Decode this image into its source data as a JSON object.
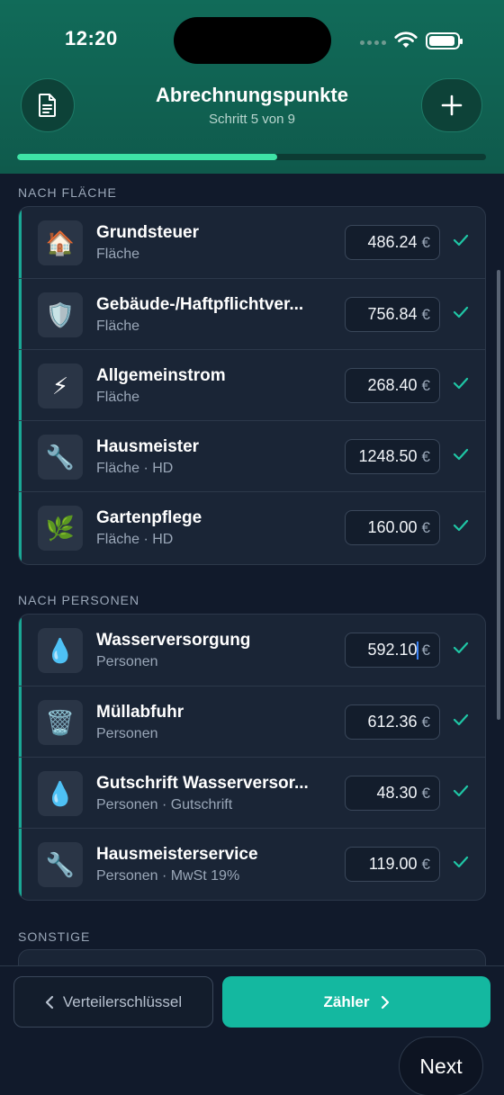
{
  "status": {
    "time": "12:20"
  },
  "header": {
    "title": "Abrechnungspunkte",
    "subtitle": "Schritt 5 von 9",
    "progress": 0.555
  },
  "sections": [
    {
      "label": "NACH FLÄCHE",
      "items": [
        {
          "icon": "house-icon",
          "glyph": "🏠",
          "title": "Grundsteuer",
          "sub": "Fläche",
          "amount": "486.24"
        },
        {
          "icon": "shield-icon",
          "glyph": "🛡️",
          "title": "Gebäude-/Haftpflichtver...",
          "sub": "Fläche",
          "amount": "756.84"
        },
        {
          "icon": "lightning-icon",
          "glyph": "⚡",
          "title": "Allgemeinstrom",
          "sub": "Fläche",
          "amount": "268.40"
        },
        {
          "icon": "wrench-icon",
          "glyph": "🔧",
          "title": "Hausmeister",
          "sub": "Fläche · HD",
          "amount": "1248.50"
        },
        {
          "icon": "herb-icon",
          "glyph": "🌿",
          "title": "Gartenpflege",
          "sub": "Fläche · HD",
          "amount": "160.00"
        }
      ]
    },
    {
      "label": "NACH PERSONEN",
      "items": [
        {
          "icon": "droplet-icon",
          "glyph": "💧",
          "title": "Wasserversorgung",
          "sub": "Personen",
          "amount": "592.10",
          "focused": true
        },
        {
          "icon": "wastebasket-icon",
          "glyph": "🗑️",
          "title": "Müllabfuhr",
          "sub": "Personen",
          "amount": "612.36"
        },
        {
          "icon": "droplet-icon",
          "glyph": "💧",
          "title": "Gutschrift Wasserversor...",
          "sub": "Personen · Gutschrift",
          "amount": "48.30"
        },
        {
          "icon": "wrench-icon",
          "glyph": "🔧",
          "title": "Hausmeisterservice",
          "sub": "Personen · MwSt 19%",
          "amount": "119.00"
        }
      ]
    },
    {
      "label": "SONSTIGE",
      "items": []
    }
  ],
  "currency": "€",
  "footer": {
    "back_label": "Verteilerschlüssel",
    "forward_label": "Zähler",
    "next_label": "Next"
  },
  "colors": {
    "accent": "#14b8a0",
    "header": "#116b59",
    "background": "#111a2b",
    "progress": "#3ee3a6"
  }
}
